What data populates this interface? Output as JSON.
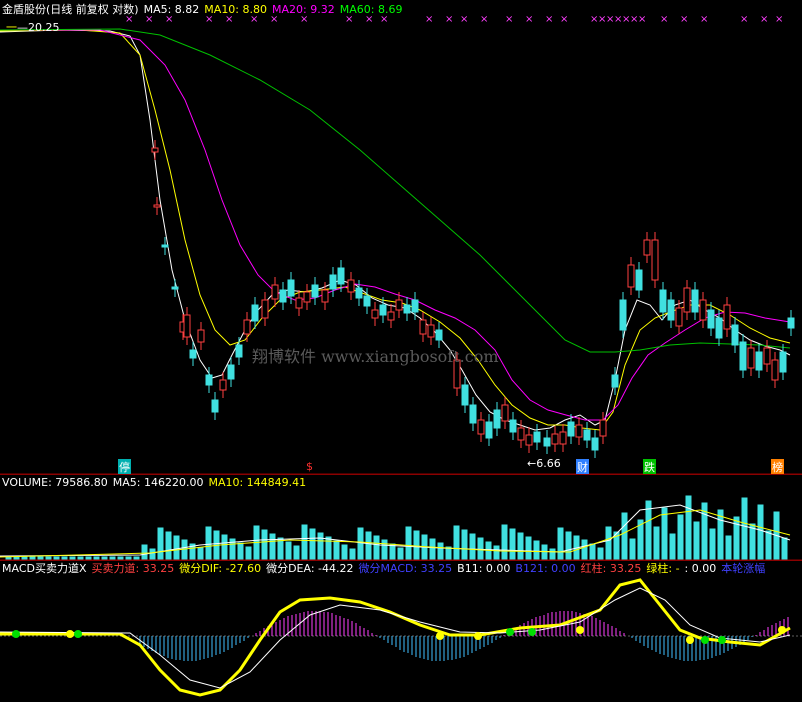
{
  "main_panel": {
    "title": "金盾股份(日线 前复权 对数)",
    "ma_items": [
      {
        "label": "MA5: 8.82",
        "color": "#ffffff"
      },
      {
        "label": "MA10: 8.80",
        "color": "#ffff00"
      },
      {
        "label": "MA20: 9.32",
        "color": "#ff00ff"
      },
      {
        "label": "MA60: 8.69",
        "color": "#00ff00"
      }
    ],
    "high_label": "20.25",
    "low_label": "6.66",
    "watermark": "翔博软件 www.xiangbosoft.com",
    "event_badges": [
      {
        "text": "停",
        "color": "#00b0b0"
      },
      {
        "text": "$",
        "color": "#ff3030"
      },
      {
        "text": "财",
        "color": "#3080ff"
      },
      {
        "text": "跌",
        "color": "#00c000"
      },
      {
        "text": "榜",
        "color": "#ff8000"
      }
    ],
    "x_markers": "×"
  },
  "volume_panel": {
    "items": [
      {
        "label": "VOLUME: 79586.80",
        "color": "#ffffff"
      },
      {
        "label": "MA5: 146220.00",
        "color": "#ffffff"
      },
      {
        "label": "MA10: 144849.41",
        "color": "#ffff00"
      }
    ]
  },
  "macd_panel": {
    "items": [
      {
        "label": "MACD买卖力道X",
        "color": "#ffffff"
      },
      {
        "label": "买卖力道: 33.25",
        "color": "#ff4040"
      },
      {
        "label": "微分DIF: -27.60",
        "color": "#ffff00"
      },
      {
        "label": "微分DEA: -44.22",
        "color": "#ffffff"
      },
      {
        "label": "微分MACD: 33.25",
        "color": "#4040ff"
      },
      {
        "label": "B11: 0.00",
        "color": "#ffffff"
      },
      {
        "label": "B121: 0.00",
        "color": "#4040ff"
      },
      {
        "label": "红柱: 33.25",
        "color": "#ff4040"
      },
      {
        "label": "绿柱: -",
        "color": "#ffff00"
      },
      {
        "label": ": 0.00",
        "color": "#ffffff"
      },
      {
        "label": "本轮涨幅",
        "color": "#4040ff"
      }
    ]
  }
}
